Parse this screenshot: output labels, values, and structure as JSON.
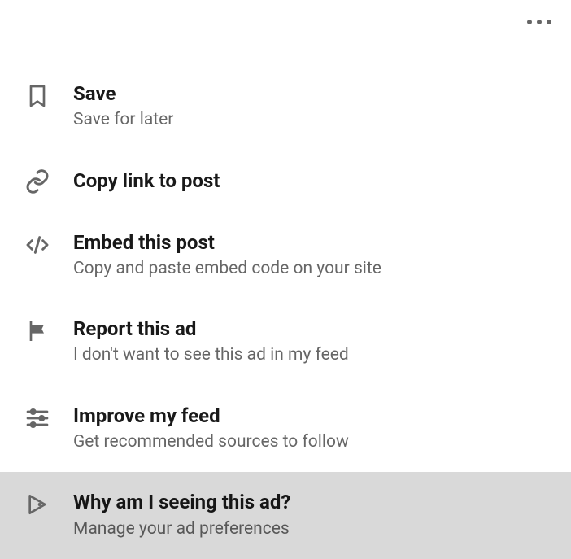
{
  "menu": {
    "items": [
      {
        "title": "Save",
        "subtitle": "Save for later"
      },
      {
        "title": "Copy link to post",
        "subtitle": ""
      },
      {
        "title": "Embed this post",
        "subtitle": "Copy and paste embed code on your site"
      },
      {
        "title": "Report this ad",
        "subtitle": "I don't want to see this ad in my feed"
      },
      {
        "title": "Improve my feed",
        "subtitle": "Get recommended sources to follow"
      },
      {
        "title": "Why am I seeing this ad?",
        "subtitle": "Manage your ad preferences"
      }
    ]
  }
}
